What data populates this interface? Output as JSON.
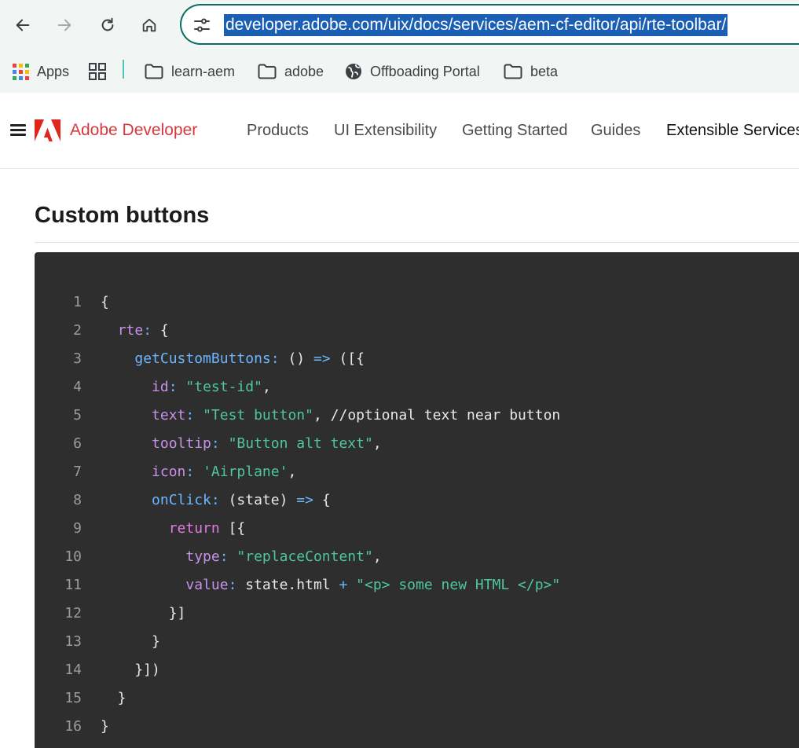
{
  "browser": {
    "url": "developer.adobe.com/uix/docs/services/aem-cf-editor/api/rte-toolbar/",
    "bookmarks": [
      "Apps",
      "learn-aem",
      "adobe",
      "Offboading Portal",
      "beta"
    ]
  },
  "site": {
    "brand": "Adobe Developer",
    "nav": [
      "Products",
      "UI Extensibility",
      "Getting Started",
      "Guides",
      "Extensible Services"
    ]
  },
  "content": {
    "heading": "Custom buttons"
  },
  "code": {
    "line_numbers": [
      "1",
      "2",
      "3",
      "4",
      "5",
      "6",
      "7",
      "8",
      "9",
      "10",
      "11",
      "12",
      "13",
      "14",
      "15",
      "16"
    ],
    "lines": [
      [
        {
          "t": "{",
          "c": "plain"
        }
      ],
      [
        {
          "t": "  ",
          "c": "plain"
        },
        {
          "t": "rte",
          "c": "key"
        },
        {
          "t": ": ",
          "c": "op"
        },
        {
          "t": "{",
          "c": "plain"
        }
      ],
      [
        {
          "t": "    ",
          "c": "plain"
        },
        {
          "t": "getCustomButtons",
          "c": "fn"
        },
        {
          "t": ": ",
          "c": "op"
        },
        {
          "t": "() ",
          "c": "plain"
        },
        {
          "t": "=>",
          "c": "op"
        },
        {
          "t": " ([{",
          "c": "plain"
        }
      ],
      [
        {
          "t": "      ",
          "c": "plain"
        },
        {
          "t": "id",
          "c": "key"
        },
        {
          "t": ": ",
          "c": "op"
        },
        {
          "t": "\"test-id\"",
          "c": "str"
        },
        {
          "t": ",",
          "c": "plain"
        }
      ],
      [
        {
          "t": "      ",
          "c": "plain"
        },
        {
          "t": "text",
          "c": "key"
        },
        {
          "t": ": ",
          "c": "op"
        },
        {
          "t": "\"Test button\"",
          "c": "str"
        },
        {
          "t": ", //optional text near button",
          "c": "plain"
        }
      ],
      [
        {
          "t": "      ",
          "c": "plain"
        },
        {
          "t": "tooltip",
          "c": "key"
        },
        {
          "t": ": ",
          "c": "op"
        },
        {
          "t": "\"Button alt text\"",
          "c": "str"
        },
        {
          "t": ",",
          "c": "plain"
        }
      ],
      [
        {
          "t": "      ",
          "c": "plain"
        },
        {
          "t": "icon",
          "c": "key"
        },
        {
          "t": ": ",
          "c": "op"
        },
        {
          "t": "'Airplane'",
          "c": "str"
        },
        {
          "t": ",",
          "c": "plain"
        }
      ],
      [
        {
          "t": "      ",
          "c": "plain"
        },
        {
          "t": "onClick",
          "c": "fn"
        },
        {
          "t": ": ",
          "c": "op"
        },
        {
          "t": "(state) ",
          "c": "plain"
        },
        {
          "t": "=>",
          "c": "op"
        },
        {
          "t": " {",
          "c": "plain"
        }
      ],
      [
        {
          "t": "        ",
          "c": "plain"
        },
        {
          "t": "return",
          "c": "kw"
        },
        {
          "t": " [{",
          "c": "plain"
        }
      ],
      [
        {
          "t": "          ",
          "c": "plain"
        },
        {
          "t": "type",
          "c": "key"
        },
        {
          "t": ": ",
          "c": "op"
        },
        {
          "t": "\"replaceContent\"",
          "c": "str"
        },
        {
          "t": ",",
          "c": "plain"
        }
      ],
      [
        {
          "t": "          ",
          "c": "plain"
        },
        {
          "t": "value",
          "c": "key"
        },
        {
          "t": ": ",
          "c": "op"
        },
        {
          "t": "state.html ",
          "c": "plain"
        },
        {
          "t": "+",
          "c": "op"
        },
        {
          "t": " \"<p> some new HTML </p>\"",
          "c": "str"
        }
      ],
      [
        {
          "t": "        }]",
          "c": "plain"
        }
      ],
      [
        {
          "t": "      }",
          "c": "plain"
        }
      ],
      [
        {
          "t": "    }])",
          "c": "plain"
        }
      ],
      [
        {
          "t": "  }",
          "c": "plain"
        }
      ],
      [
        {
          "t": "}",
          "c": "plain"
        }
      ]
    ],
    "colors": {
      "plain": "#e8e8e8",
      "key": "#c792ea",
      "fn": "#6cb6ff",
      "op": "#6cb6ff",
      "str": "#4ec79a",
      "kw": "#e27be0"
    }
  },
  "theme": {
    "omnibox_border": "#0b6e62",
    "url_highlight": "#1a5fb4",
    "brand_red": "#e1251b",
    "code_bg": "#2e2e2e"
  }
}
